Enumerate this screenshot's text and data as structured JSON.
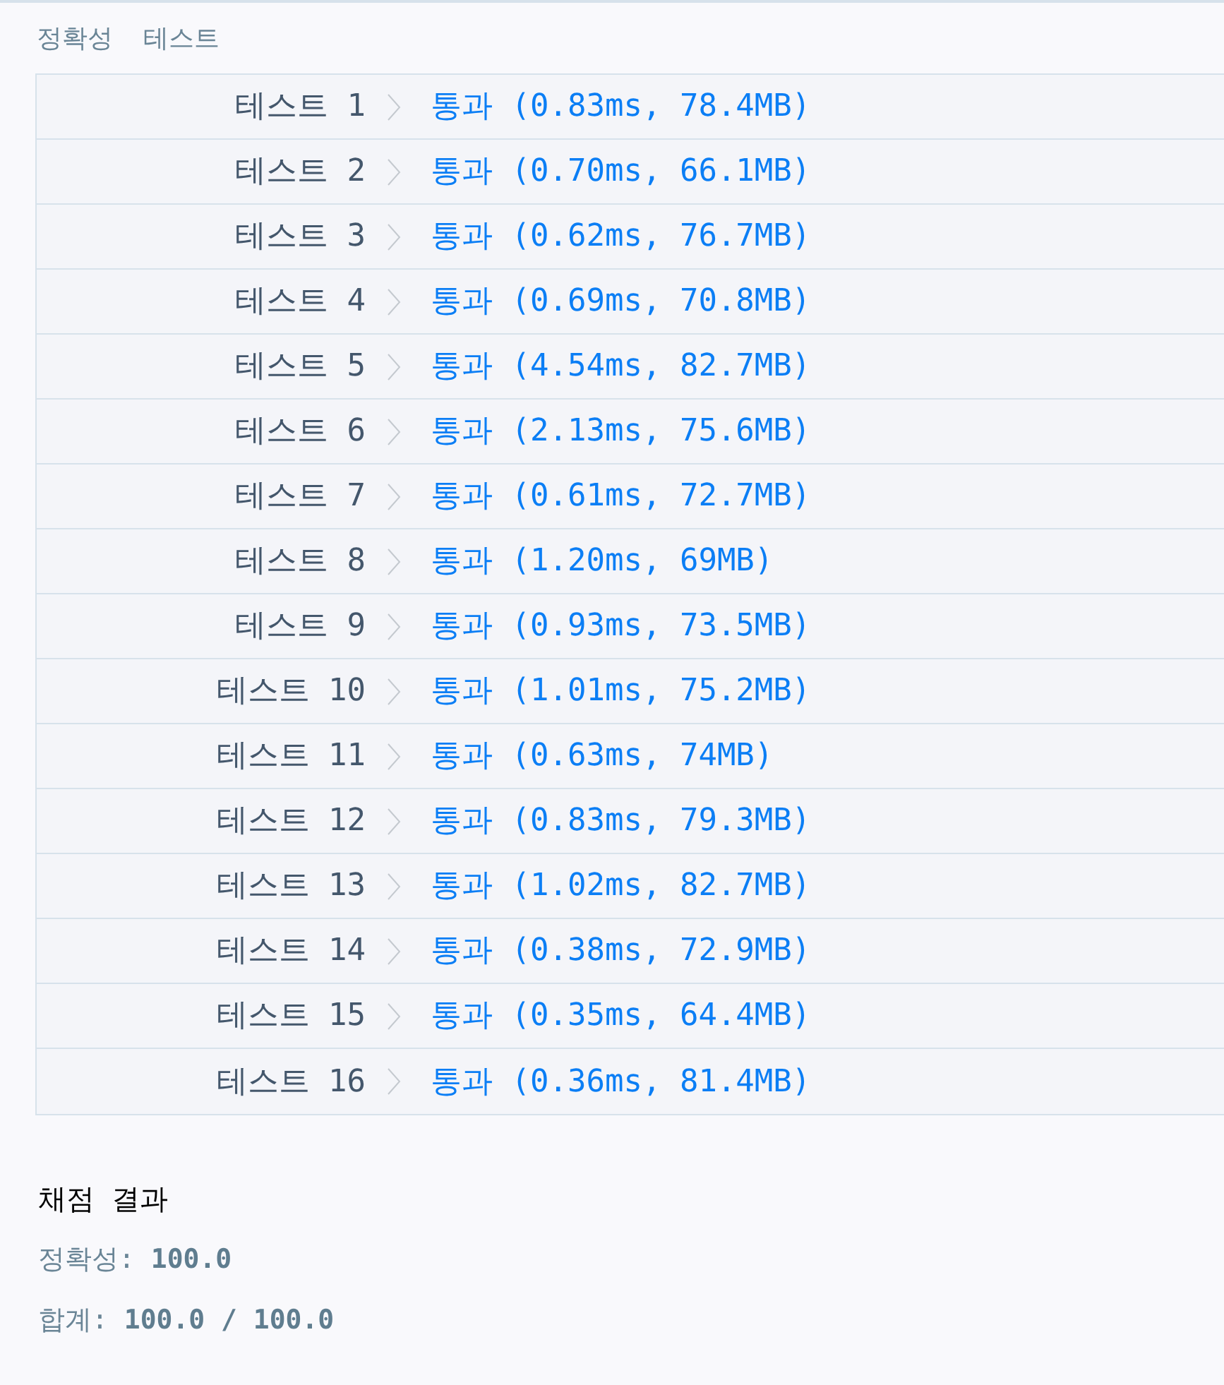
{
  "header": {
    "title": "정확성  테스트"
  },
  "tests": [
    {
      "label": "테스트 1",
      "result": "통과 (0.83ms, 78.4MB)"
    },
    {
      "label": "테스트 2",
      "result": "통과 (0.70ms, 66.1MB)"
    },
    {
      "label": "테스트 3",
      "result": "통과 (0.62ms, 76.7MB)"
    },
    {
      "label": "테스트 4",
      "result": "통과 (0.69ms, 70.8MB)"
    },
    {
      "label": "테스트 5",
      "result": "통과 (4.54ms, 82.7MB)"
    },
    {
      "label": "테스트 6",
      "result": "통과 (2.13ms, 75.6MB)"
    },
    {
      "label": "테스트 7",
      "result": "통과 (0.61ms, 72.7MB)"
    },
    {
      "label": "테스트 8",
      "result": "통과 (1.20ms, 69MB)"
    },
    {
      "label": "테스트 9",
      "result": "통과 (0.93ms, 73.5MB)"
    },
    {
      "label": "테스트 10",
      "result": "통과 (1.01ms, 75.2MB)"
    },
    {
      "label": "테스트 11",
      "result": "통과 (0.63ms, 74MB)"
    },
    {
      "label": "테스트 12",
      "result": "통과 (0.83ms, 79.3MB)"
    },
    {
      "label": "테스트 13",
      "result": "통과 (1.02ms, 82.7MB)"
    },
    {
      "label": "테스트 14",
      "result": "통과 (0.38ms, 72.9MB)"
    },
    {
      "label": "테스트 15",
      "result": "통과 (0.35ms, 64.4MB)"
    },
    {
      "label": "테스트 16",
      "result": "통과 (0.36ms, 81.4MB)"
    }
  ],
  "summary": {
    "title": "채점 결과",
    "lines": [
      "정확성: **100.0**",
      "합계: **100.0 / 100.0**"
    ]
  }
}
